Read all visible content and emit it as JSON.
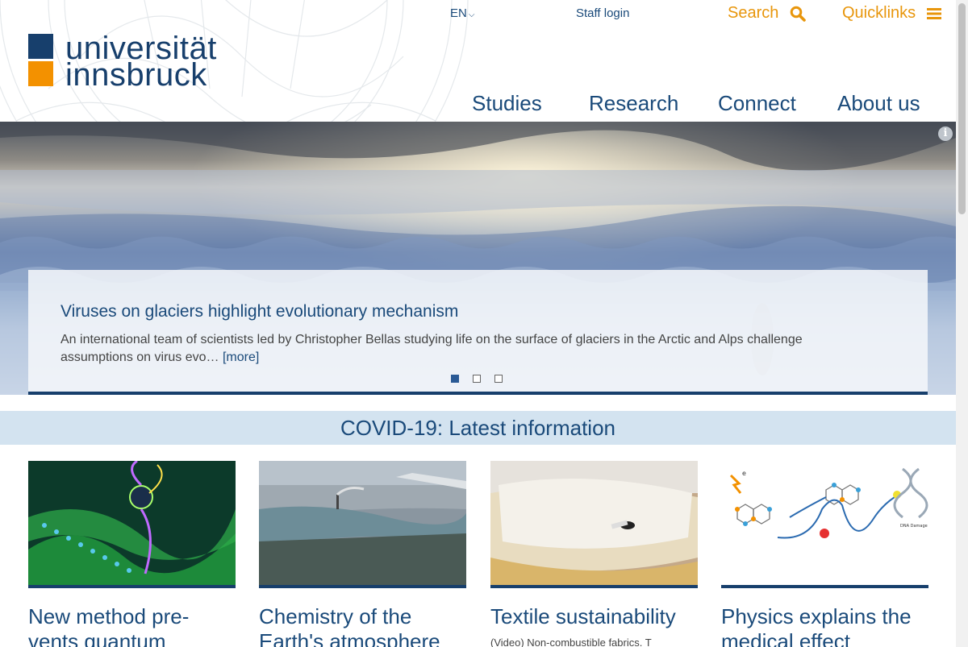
{
  "header": {
    "logo_line1": "universität",
    "logo_line2": "innsbruck",
    "lang": "EN",
    "staff_login": "Staff login",
    "search": "Search",
    "quicklinks": "Quicklinks",
    "nav": [
      "Studies",
      "Research",
      "Connect",
      "About us"
    ]
  },
  "hero": {
    "title": "Viruses on glaciers highlight evolutionary mechanism",
    "text": "An international team of scientists led by Christopher Bellas studying life on the surface of glaciers in the Arctic and Alps challenge assumptions on virus evo…",
    "more": "[more]",
    "slides": 3,
    "active_slide": 1
  },
  "covid_banner": "COVID-19: Latest information",
  "cards": [
    {
      "title": "New method pre-vents quantum",
      "subtitle": ""
    },
    {
      "title": "Chemistry of the Earth's atmosphere",
      "subtitle": ""
    },
    {
      "title": "Textile sustainability",
      "subtitle": "(Video) Non-combustible fabrics. T"
    },
    {
      "title": "Physics explains the medical effect",
      "subtitle": ""
    }
  ],
  "diagram_labels": {
    "electron": "e",
    "dna": "DNA Damage"
  },
  "colors": {
    "brand_blue": "#173f6c",
    "brand_orange": "#f39100",
    "link_blue": "#1a4a7a",
    "accent_orange": "#e8960c",
    "covid_bg": "#d3e3f0"
  },
  "icons": {
    "search": "search-icon",
    "quicklinks": "menu-icon",
    "language": "chevron-down-icon",
    "info": "info-icon"
  }
}
